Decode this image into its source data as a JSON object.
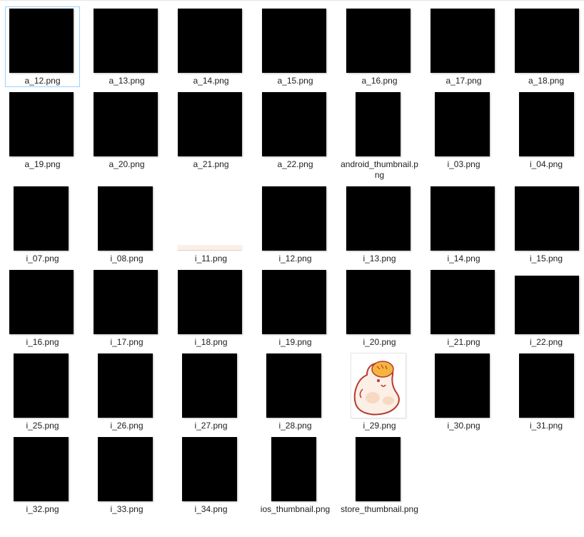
{
  "window": {
    "view_mode": "Large icons"
  },
  "files": [
    {
      "name": "a_12.png",
      "selected": true
    },
    {
      "name": "a_13.png"
    },
    {
      "name": "a_14.png"
    },
    {
      "name": "a_15.png"
    },
    {
      "name": "a_16.png"
    },
    {
      "name": "a_17.png"
    },
    {
      "name": "a_18.png"
    },
    {
      "name": "a_19.png"
    },
    {
      "name": "a_20.png"
    },
    {
      "name": "a_21.png"
    },
    {
      "name": "a_22.png"
    },
    {
      "name": "android_thumbnail.png"
    },
    {
      "name": "i_03.png"
    },
    {
      "name": "i_04.png"
    },
    {
      "name": "i_07.png"
    },
    {
      "name": "i_08.png"
    },
    {
      "name": "i_11.png"
    },
    {
      "name": "i_12.png"
    },
    {
      "name": "i_13.png"
    },
    {
      "name": "i_14.png"
    },
    {
      "name": "i_15.png"
    },
    {
      "name": "i_16.png"
    },
    {
      "name": "i_17.png"
    },
    {
      "name": "i_18.png"
    },
    {
      "name": "i_19.png"
    },
    {
      "name": "i_20.png"
    },
    {
      "name": "i_21.png"
    },
    {
      "name": "i_22.png"
    },
    {
      "name": "i_25.png"
    },
    {
      "name": "i_26.png"
    },
    {
      "name": "i_27.png"
    },
    {
      "name": "i_28.png"
    },
    {
      "name": "i_29.png"
    },
    {
      "name": "i_30.png"
    },
    {
      "name": "i_31.png"
    },
    {
      "name": "i_32.png"
    },
    {
      "name": "i_33.png"
    },
    {
      "name": "i_34.png"
    },
    {
      "name": "ios_thumbnail.png"
    },
    {
      "name": "store_thumbnail.png"
    }
  ],
  "colors": {
    "selection_border": "#99d1ff",
    "thumbnail_dark": "#000000",
    "label_text": "#1e1e1e",
    "character_outline": "#b83a2f",
    "character_head": "#f4b53f"
  }
}
